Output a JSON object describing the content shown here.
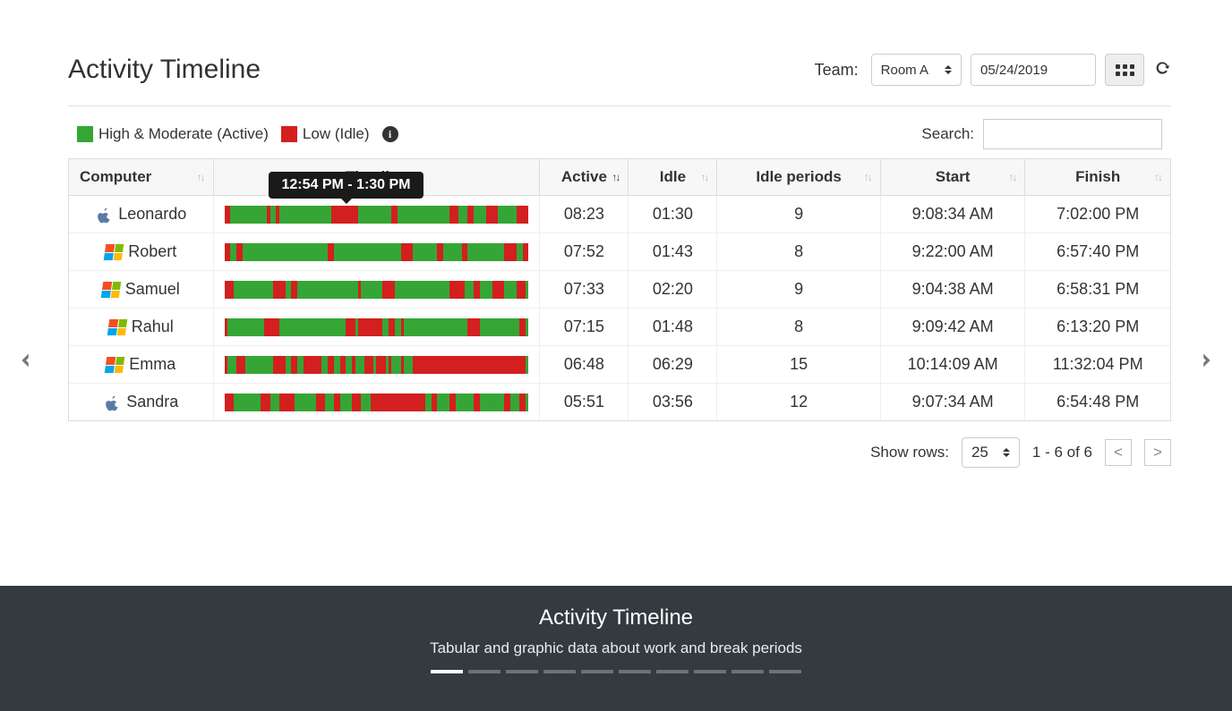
{
  "header": {
    "title": "Activity Timeline",
    "team_label": "Team:",
    "team_value": "Room A",
    "date_value": "05/24/2019"
  },
  "legend": {
    "active_label": "High & Moderate (Active)",
    "idle_label": "Low (Idle)"
  },
  "search": {
    "label": "Search:"
  },
  "columns": {
    "computer": "Computer",
    "timeline": "Timeline",
    "active": "Active",
    "idle": "Idle",
    "idle_periods": "Idle periods",
    "start": "Start",
    "finish": "Finish"
  },
  "tooltip": "12:54 PM - 1:30 PM",
  "rows": [
    {
      "os": "mac",
      "name": "Leonardo",
      "active": "08:23",
      "idle": "01:30",
      "periods": "9",
      "start": "9:08:34 AM",
      "finish": "7:02:00 PM",
      "idle_segments": [
        [
          0,
          2
        ],
        [
          14,
          1
        ],
        [
          17,
          1
        ],
        [
          35,
          9
        ],
        [
          55,
          2
        ],
        [
          74,
          3
        ],
        [
          80,
          2
        ],
        [
          86,
          4
        ],
        [
          96,
          4
        ]
      ]
    },
    {
      "os": "win",
      "name": "Robert",
      "active": "07:52",
      "idle": "01:43",
      "periods": "8",
      "start": "9:22:00 AM",
      "finish": "6:57:40 PM",
      "idle_segments": [
        [
          0,
          2
        ],
        [
          4,
          2
        ],
        [
          34,
          2
        ],
        [
          58,
          4
        ],
        [
          70,
          2
        ],
        [
          78,
          2
        ],
        [
          92,
          4
        ],
        [
          98,
          2
        ]
      ]
    },
    {
      "os": "win",
      "name": "Samuel",
      "active": "07:33",
      "idle": "02:20",
      "periods": "9",
      "start": "9:04:38 AM",
      "finish": "6:58:31 PM",
      "idle_segments": [
        [
          0,
          3
        ],
        [
          16,
          4
        ],
        [
          22,
          2
        ],
        [
          44,
          1
        ],
        [
          52,
          4
        ],
        [
          74,
          5
        ],
        [
          82,
          2
        ],
        [
          88,
          4
        ],
        [
          96,
          3
        ]
      ]
    },
    {
      "os": "win",
      "name": "Rahul",
      "active": "07:15",
      "idle": "01:48",
      "periods": "8",
      "start": "9:09:42 AM",
      "finish": "6:13:20 PM",
      "idle_segments": [
        [
          0,
          1
        ],
        [
          13,
          5
        ],
        [
          40,
          3
        ],
        [
          44,
          8
        ],
        [
          54,
          2
        ],
        [
          58,
          1
        ],
        [
          80,
          4
        ],
        [
          97,
          2
        ]
      ]
    },
    {
      "os": "win",
      "name": "Emma",
      "active": "06:48",
      "idle": "06:29",
      "periods": "15",
      "start": "10:14:09 AM",
      "finish": "11:32:04 PM",
      "idle_segments": [
        [
          0,
          1
        ],
        [
          4,
          3
        ],
        [
          16,
          4
        ],
        [
          22,
          2
        ],
        [
          26,
          6
        ],
        [
          34,
          2
        ],
        [
          38,
          2
        ],
        [
          42,
          1
        ],
        [
          46,
          3
        ],
        [
          50,
          3
        ],
        [
          54,
          1
        ],
        [
          58,
          1
        ],
        [
          62,
          36
        ],
        [
          98,
          1
        ]
      ]
    },
    {
      "os": "mac",
      "name": "Sandra",
      "active": "05:51",
      "idle": "03:56",
      "periods": "12",
      "start": "9:07:34 AM",
      "finish": "6:54:48 PM",
      "idle_segments": [
        [
          0,
          3
        ],
        [
          12,
          3
        ],
        [
          18,
          5
        ],
        [
          30,
          3
        ],
        [
          36,
          2
        ],
        [
          42,
          3
        ],
        [
          48,
          18
        ],
        [
          68,
          2
        ],
        [
          74,
          2
        ],
        [
          82,
          2
        ],
        [
          92,
          2
        ],
        [
          97,
          2
        ]
      ]
    }
  ],
  "pager": {
    "show_rows_label": "Show rows:",
    "rows_value": "25",
    "range": "1 - 6 of 6"
  },
  "caption": {
    "title": "Activity Timeline",
    "subtitle": "Tabular and graphic data about work and break periods",
    "slides": 10,
    "active_slide": 0
  }
}
